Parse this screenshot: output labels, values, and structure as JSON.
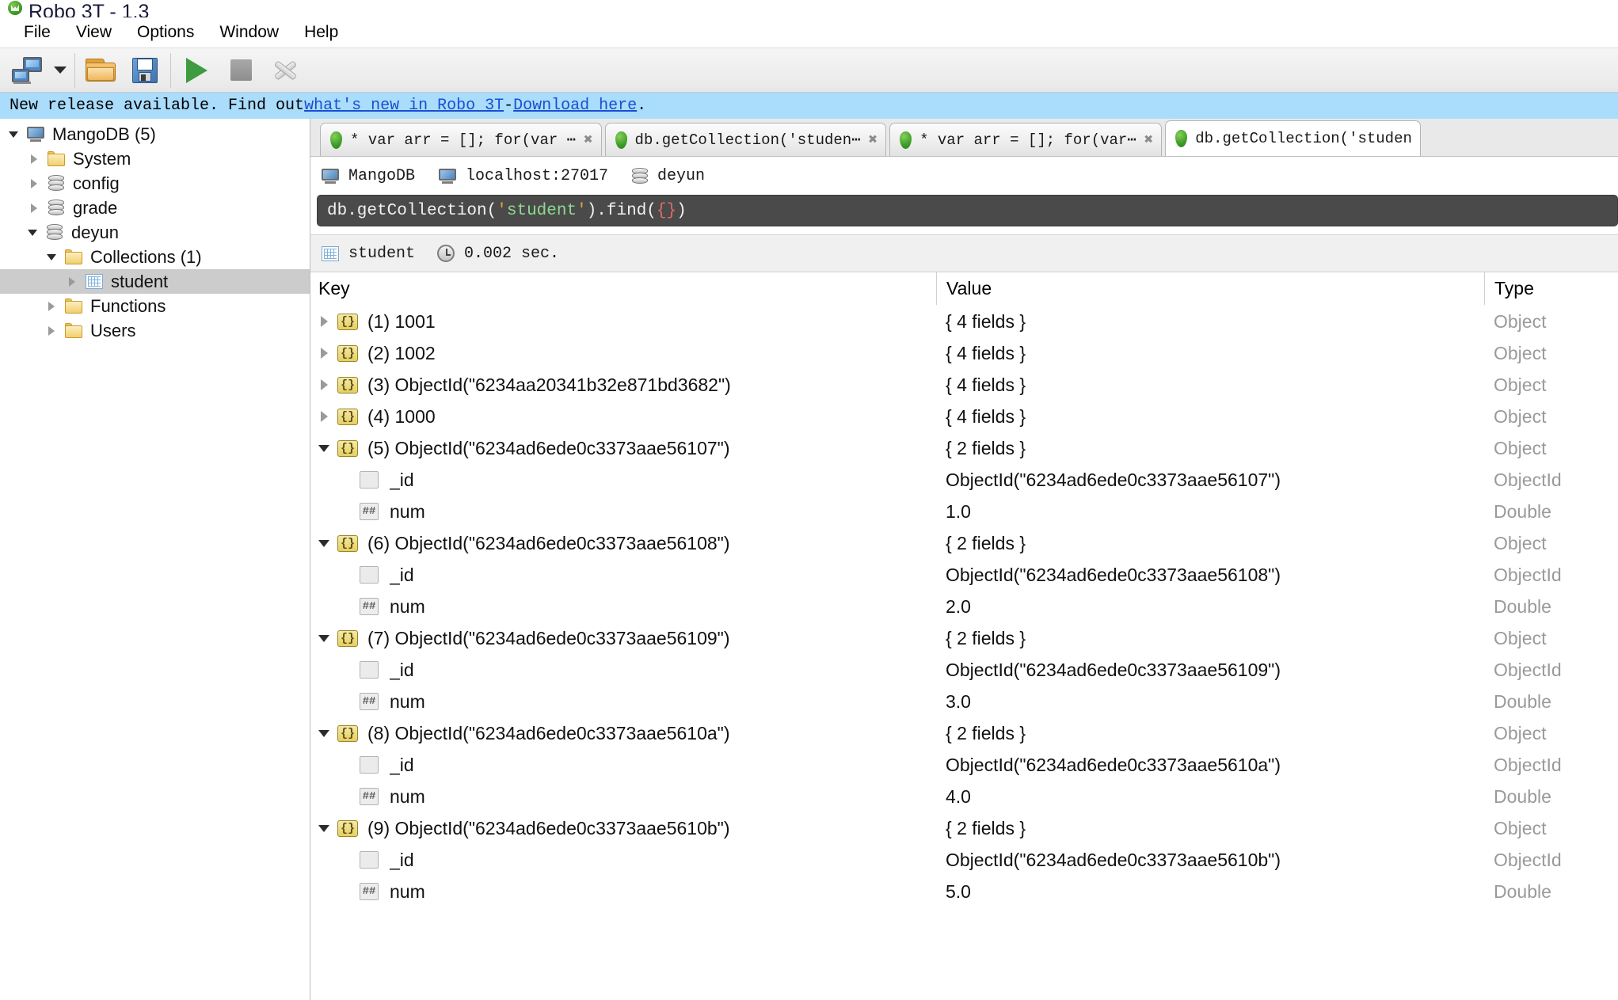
{
  "window": {
    "title": "Robo 3T - 1.3",
    "app_icon": "mongodb-leaf-icon"
  },
  "menubar": {
    "items": [
      {
        "label": "File"
      },
      {
        "label": "View"
      },
      {
        "label": "Options"
      },
      {
        "label": "Window"
      },
      {
        "label": "Help"
      }
    ]
  },
  "toolbar": {
    "buttons": [
      {
        "name": "connect-button",
        "icon": "computers-icon"
      },
      {
        "name": "connect-dropdown-button",
        "icon": "caret-down-icon"
      },
      {
        "name": "open-script-button",
        "icon": "folder-icon"
      },
      {
        "name": "save-script-button",
        "icon": "floppy-disk-icon"
      },
      {
        "name": "execute-button",
        "icon": "play-icon"
      },
      {
        "name": "stop-button",
        "icon": "stop-icon"
      },
      {
        "name": "tools-button",
        "icon": "wrench-icon"
      }
    ]
  },
  "notification": {
    "text_before": "New release available. Find out ",
    "link1": "what's new in Robo 3T",
    "separator": " - ",
    "link2": "Download here",
    "text_after": "."
  },
  "sidebar": {
    "tree": [
      {
        "label": "MangoDB (5)",
        "icon": "server-icon",
        "indent": 0,
        "state": "expanded",
        "selected": false
      },
      {
        "label": "System",
        "icon": "folder-icon",
        "indent": 1,
        "state": "collapsed",
        "selected": false
      },
      {
        "label": "config",
        "icon": "database-icon",
        "indent": 1,
        "state": "collapsed",
        "selected": false
      },
      {
        "label": "grade",
        "icon": "database-icon",
        "indent": 1,
        "state": "collapsed",
        "selected": false
      },
      {
        "label": "deyun",
        "icon": "database-icon",
        "indent": 1,
        "state": "expanded",
        "selected": false
      },
      {
        "label": "Collections (1)",
        "icon": "folder-icon",
        "indent": 2,
        "state": "expanded",
        "selected": false
      },
      {
        "label": "student",
        "icon": "collection-grid-icon",
        "indent": 3,
        "state": "collapsed",
        "selected": true
      },
      {
        "label": "Functions",
        "icon": "folder-icon",
        "indent": 2,
        "state": "collapsed",
        "selected": false
      },
      {
        "label": "Users",
        "icon": "folder-icon",
        "indent": 2,
        "state": "collapsed",
        "selected": false
      }
    ]
  },
  "tabs": {
    "close_glyph": "✖",
    "items": [
      {
        "label": "* var arr = []; for(var ⋯",
        "active": false,
        "closable": true
      },
      {
        "label": "db.getCollection('studen⋯",
        "active": false,
        "closable": true
      },
      {
        "label": "* var arr = []; for(var⋯",
        "active": false,
        "closable": true
      },
      {
        "label": "db.getCollection('studen",
        "active": true,
        "closable": false
      }
    ]
  },
  "connection_info": {
    "server": "MangoDB",
    "host": "localhost:27017",
    "database": "deyun"
  },
  "query_editor": {
    "prefix": "db.getCollection(",
    "quote_open": "'",
    "string": "student",
    "quote_close": "'",
    "middle": ").find(",
    "braces": "{}",
    "suffix": ")",
    "full_text": "db.getCollection('student').find({})"
  },
  "result_info": {
    "collection": "student",
    "time": "0.002 sec."
  },
  "results_table": {
    "columns": [
      "Key",
      "Value",
      "Type"
    ],
    "rows": [
      {
        "indent": 0,
        "expander": "collapsed",
        "icon": "document-icon",
        "key": "(1) 1001",
        "value": "{ 4 fields }",
        "type": "Object"
      },
      {
        "indent": 0,
        "expander": "collapsed",
        "icon": "document-icon",
        "key": "(2) 1002",
        "value": "{ 4 fields }",
        "type": "Object"
      },
      {
        "indent": 0,
        "expander": "collapsed",
        "icon": "document-icon",
        "key": "(3) ObjectId(\"6234aa20341b32e871bd3682\")",
        "value": "{ 4 fields }",
        "type": "Object"
      },
      {
        "indent": 0,
        "expander": "collapsed",
        "icon": "document-icon",
        "key": "(4) 1000",
        "value": "{ 4 fields }",
        "type": "Object"
      },
      {
        "indent": 0,
        "expander": "expanded",
        "icon": "document-icon",
        "key": "(5) ObjectId(\"6234ad6ede0c3373aae56107\")",
        "value": "{ 2 fields }",
        "type": "Object"
      },
      {
        "indent": 1,
        "expander": "none",
        "icon": "blank-field-icon",
        "key": "_id",
        "value": "ObjectId(\"6234ad6ede0c3373aae56107\")",
        "type": "ObjectId"
      },
      {
        "indent": 1,
        "expander": "none",
        "icon": "number-field-icon",
        "key": "num",
        "value": "1.0",
        "type": "Double"
      },
      {
        "indent": 0,
        "expander": "expanded",
        "icon": "document-icon",
        "key": "(6) ObjectId(\"6234ad6ede0c3373aae56108\")",
        "value": "{ 2 fields }",
        "type": "Object"
      },
      {
        "indent": 1,
        "expander": "none",
        "icon": "blank-field-icon",
        "key": "_id",
        "value": "ObjectId(\"6234ad6ede0c3373aae56108\")",
        "type": "ObjectId"
      },
      {
        "indent": 1,
        "expander": "none",
        "icon": "number-field-icon",
        "key": "num",
        "value": "2.0",
        "type": "Double"
      },
      {
        "indent": 0,
        "expander": "expanded",
        "icon": "document-icon",
        "key": "(7) ObjectId(\"6234ad6ede0c3373aae56109\")",
        "value": "{ 2 fields }",
        "type": "Object"
      },
      {
        "indent": 1,
        "expander": "none",
        "icon": "blank-field-icon",
        "key": "_id",
        "value": "ObjectId(\"6234ad6ede0c3373aae56109\")",
        "type": "ObjectId"
      },
      {
        "indent": 1,
        "expander": "none",
        "icon": "number-field-icon",
        "key": "num",
        "value": "3.0",
        "type": "Double"
      },
      {
        "indent": 0,
        "expander": "expanded",
        "icon": "document-icon",
        "key": "(8) ObjectId(\"6234ad6ede0c3373aae5610a\")",
        "value": "{ 2 fields }",
        "type": "Object"
      },
      {
        "indent": 1,
        "expander": "none",
        "icon": "blank-field-icon",
        "key": "_id",
        "value": "ObjectId(\"6234ad6ede0c3373aae5610a\")",
        "type": "ObjectId"
      },
      {
        "indent": 1,
        "expander": "none",
        "icon": "number-field-icon",
        "key": "num",
        "value": "4.0",
        "type": "Double"
      },
      {
        "indent": 0,
        "expander": "expanded",
        "icon": "document-icon",
        "key": "(9) ObjectId(\"6234ad6ede0c3373aae5610b\")",
        "value": "{ 2 fields }",
        "type": "Object"
      },
      {
        "indent": 1,
        "expander": "none",
        "icon": "blank-field-icon",
        "key": "_id",
        "value": "ObjectId(\"6234ad6ede0c3373aae5610b\")",
        "type": "ObjectId"
      },
      {
        "indent": 1,
        "expander": "none",
        "icon": "number-field-icon",
        "key": "num",
        "value": "5.0",
        "type": "Double"
      }
    ]
  },
  "colors": {
    "notification_bg": "#aadcfb",
    "link": "#1a4fd0",
    "selection": "#cccccc",
    "editor_bg": "#4a4a4a",
    "accent_green": "#3f9b3f",
    "type_text": "#9a9a9a"
  }
}
